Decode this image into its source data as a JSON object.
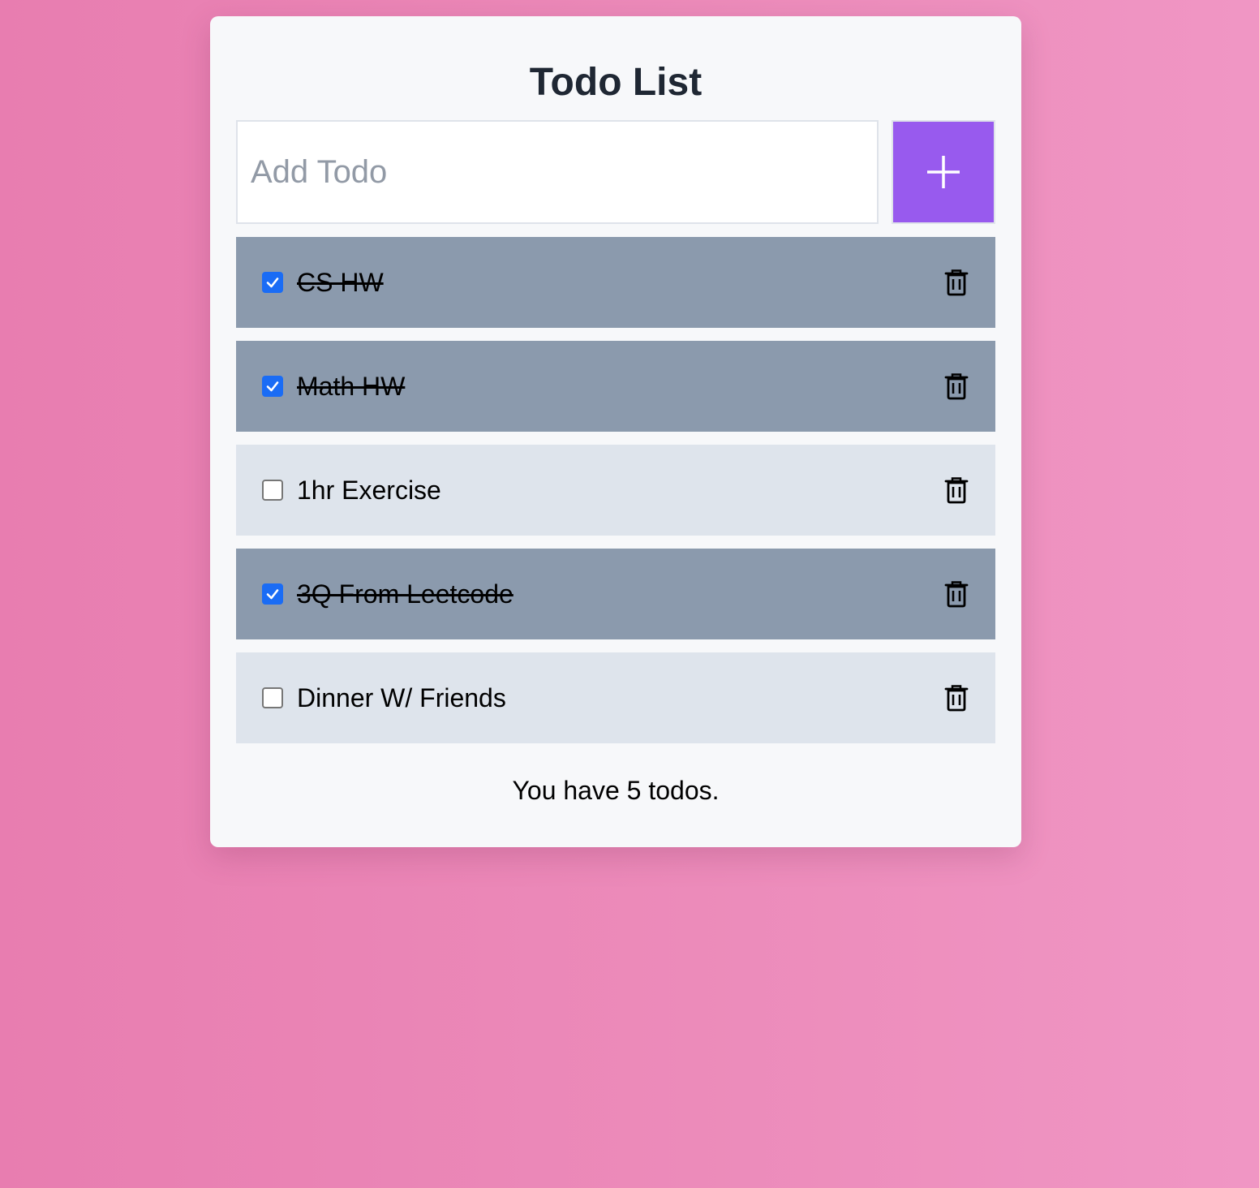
{
  "app": {
    "title": "Todo List"
  },
  "add": {
    "placeholder": "Add Todo",
    "button_icon": "plus-icon"
  },
  "todos": [
    {
      "label": "CS HW",
      "done": true
    },
    {
      "label": "Math HW",
      "done": true
    },
    {
      "label": "1hr Exercise",
      "done": false
    },
    {
      "label": "3Q From Leetcode",
      "done": true
    },
    {
      "label": "Dinner W/ Friends",
      "done": false
    }
  ],
  "footer": {
    "summary": "You have 5 todos."
  },
  "colors": {
    "accent": "#985aee",
    "done_row": "#8b9aad",
    "open_row": "#dee4ec",
    "checkbox": "#1a6cf5"
  }
}
